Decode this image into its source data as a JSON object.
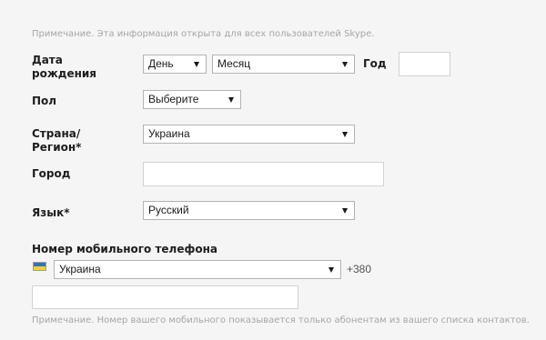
{
  "notes": {
    "top": "Примечание. Эта информация открыта для всех пользователей Skype.",
    "bottom": "Примечание. Номер вашего мобильного показывается только абонентам из вашего списка контактов."
  },
  "birthdate": {
    "label_line1": "Дата",
    "label_line2": "рождения",
    "day_value": "День",
    "month_value": "Месяц",
    "year_label": "Год",
    "year_value": ""
  },
  "gender": {
    "label": "Пол",
    "value": "Выберите"
  },
  "country": {
    "label_line1": "Страна/",
    "label_line2": "Регион*",
    "value": "Украина"
  },
  "city": {
    "label": "Город",
    "value": ""
  },
  "language": {
    "label": "Язык*",
    "value": "Русский"
  },
  "mobile": {
    "label": "Номер мобильного телефона",
    "country_value": "Украина",
    "prefix": "+380",
    "number_value": "",
    "flag_icon": "ukraine-flag-icon",
    "flag_colors": {
      "top": "#2f6fce",
      "bottom": "#f2d41a"
    }
  },
  "icons": {
    "dropdown": "chevron-down-icon"
  }
}
